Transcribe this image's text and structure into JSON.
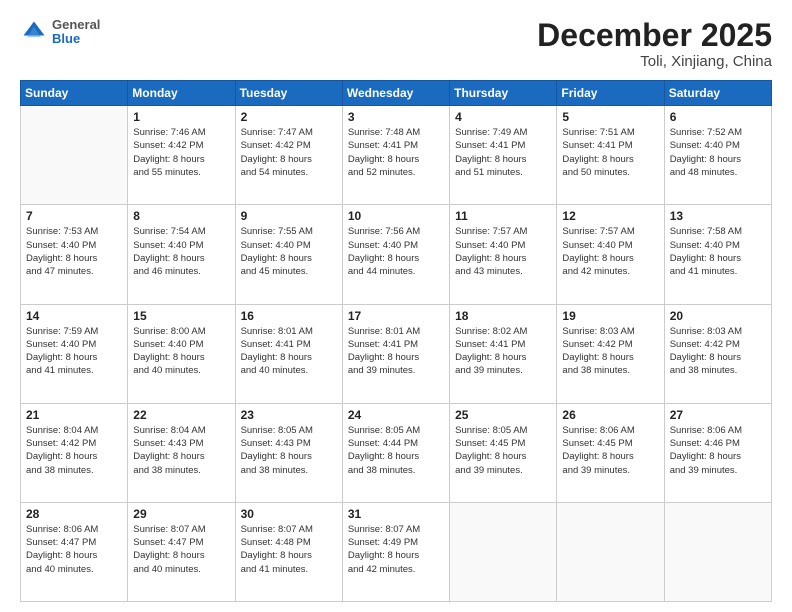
{
  "header": {
    "logo_general": "General",
    "logo_blue": "Blue",
    "month_title": "December 2025",
    "location": "Toli, Xinjiang, China"
  },
  "days_of_week": [
    "Sunday",
    "Monday",
    "Tuesday",
    "Wednesday",
    "Thursday",
    "Friday",
    "Saturday"
  ],
  "weeks": [
    [
      {
        "day": "",
        "info": ""
      },
      {
        "day": "1",
        "info": "Sunrise: 7:46 AM\nSunset: 4:42 PM\nDaylight: 8 hours\nand 55 minutes."
      },
      {
        "day": "2",
        "info": "Sunrise: 7:47 AM\nSunset: 4:42 PM\nDaylight: 8 hours\nand 54 minutes."
      },
      {
        "day": "3",
        "info": "Sunrise: 7:48 AM\nSunset: 4:41 PM\nDaylight: 8 hours\nand 52 minutes."
      },
      {
        "day": "4",
        "info": "Sunrise: 7:49 AM\nSunset: 4:41 PM\nDaylight: 8 hours\nand 51 minutes."
      },
      {
        "day": "5",
        "info": "Sunrise: 7:51 AM\nSunset: 4:41 PM\nDaylight: 8 hours\nand 50 minutes."
      },
      {
        "day": "6",
        "info": "Sunrise: 7:52 AM\nSunset: 4:40 PM\nDaylight: 8 hours\nand 48 minutes."
      }
    ],
    [
      {
        "day": "7",
        "info": "Sunrise: 7:53 AM\nSunset: 4:40 PM\nDaylight: 8 hours\nand 47 minutes."
      },
      {
        "day": "8",
        "info": "Sunrise: 7:54 AM\nSunset: 4:40 PM\nDaylight: 8 hours\nand 46 minutes."
      },
      {
        "day": "9",
        "info": "Sunrise: 7:55 AM\nSunset: 4:40 PM\nDaylight: 8 hours\nand 45 minutes."
      },
      {
        "day": "10",
        "info": "Sunrise: 7:56 AM\nSunset: 4:40 PM\nDaylight: 8 hours\nand 44 minutes."
      },
      {
        "day": "11",
        "info": "Sunrise: 7:57 AM\nSunset: 4:40 PM\nDaylight: 8 hours\nand 43 minutes."
      },
      {
        "day": "12",
        "info": "Sunrise: 7:57 AM\nSunset: 4:40 PM\nDaylight: 8 hours\nand 42 minutes."
      },
      {
        "day": "13",
        "info": "Sunrise: 7:58 AM\nSunset: 4:40 PM\nDaylight: 8 hours\nand 41 minutes."
      }
    ],
    [
      {
        "day": "14",
        "info": "Sunrise: 7:59 AM\nSunset: 4:40 PM\nDaylight: 8 hours\nand 41 minutes."
      },
      {
        "day": "15",
        "info": "Sunrise: 8:00 AM\nSunset: 4:40 PM\nDaylight: 8 hours\nand 40 minutes."
      },
      {
        "day": "16",
        "info": "Sunrise: 8:01 AM\nSunset: 4:41 PM\nDaylight: 8 hours\nand 40 minutes."
      },
      {
        "day": "17",
        "info": "Sunrise: 8:01 AM\nSunset: 4:41 PM\nDaylight: 8 hours\nand 39 minutes."
      },
      {
        "day": "18",
        "info": "Sunrise: 8:02 AM\nSunset: 4:41 PM\nDaylight: 8 hours\nand 39 minutes."
      },
      {
        "day": "19",
        "info": "Sunrise: 8:03 AM\nSunset: 4:42 PM\nDaylight: 8 hours\nand 38 minutes."
      },
      {
        "day": "20",
        "info": "Sunrise: 8:03 AM\nSunset: 4:42 PM\nDaylight: 8 hours\nand 38 minutes."
      }
    ],
    [
      {
        "day": "21",
        "info": "Sunrise: 8:04 AM\nSunset: 4:42 PM\nDaylight: 8 hours\nand 38 minutes."
      },
      {
        "day": "22",
        "info": "Sunrise: 8:04 AM\nSunset: 4:43 PM\nDaylight: 8 hours\nand 38 minutes."
      },
      {
        "day": "23",
        "info": "Sunrise: 8:05 AM\nSunset: 4:43 PM\nDaylight: 8 hours\nand 38 minutes."
      },
      {
        "day": "24",
        "info": "Sunrise: 8:05 AM\nSunset: 4:44 PM\nDaylight: 8 hours\nand 38 minutes."
      },
      {
        "day": "25",
        "info": "Sunrise: 8:05 AM\nSunset: 4:45 PM\nDaylight: 8 hours\nand 39 minutes."
      },
      {
        "day": "26",
        "info": "Sunrise: 8:06 AM\nSunset: 4:45 PM\nDaylight: 8 hours\nand 39 minutes."
      },
      {
        "day": "27",
        "info": "Sunrise: 8:06 AM\nSunset: 4:46 PM\nDaylight: 8 hours\nand 39 minutes."
      }
    ],
    [
      {
        "day": "28",
        "info": "Sunrise: 8:06 AM\nSunset: 4:47 PM\nDaylight: 8 hours\nand 40 minutes."
      },
      {
        "day": "29",
        "info": "Sunrise: 8:07 AM\nSunset: 4:47 PM\nDaylight: 8 hours\nand 40 minutes."
      },
      {
        "day": "30",
        "info": "Sunrise: 8:07 AM\nSunset: 4:48 PM\nDaylight: 8 hours\nand 41 minutes."
      },
      {
        "day": "31",
        "info": "Sunrise: 8:07 AM\nSunset: 4:49 PM\nDaylight: 8 hours\nand 42 minutes."
      },
      {
        "day": "",
        "info": ""
      },
      {
        "day": "",
        "info": ""
      },
      {
        "day": "",
        "info": ""
      }
    ]
  ]
}
